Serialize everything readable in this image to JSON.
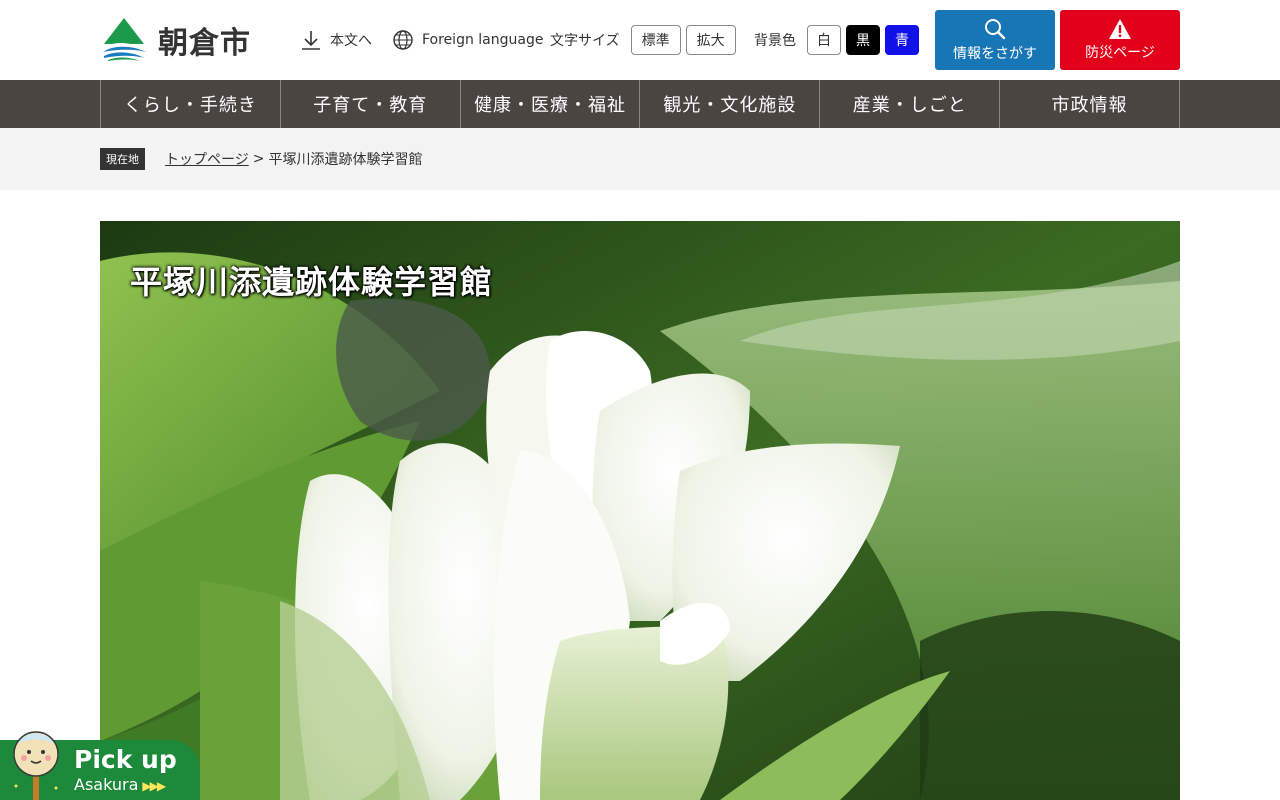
{
  "header": {
    "site_name": "朝倉市",
    "skip_link": "本文へ",
    "foreign_language": "Foreign language",
    "font_size": {
      "label": "文字サイズ",
      "options": [
        "標準",
        "拡大"
      ]
    },
    "bg_color": {
      "label": "背景色",
      "options": [
        "白",
        "黒",
        "青"
      ]
    },
    "search_button": "情報をさがす",
    "disaster_button": "防災ページ"
  },
  "nav": {
    "items": [
      "くらし・手続き",
      "子育て・教育",
      "健康・医療・福祉",
      "観光・文化施設",
      "産業・しごと",
      "市政情報"
    ]
  },
  "breadcrumb": {
    "tag": "現在地",
    "home": "トップページ",
    "separator": ">",
    "current": "平塚川添遺跡体験学習館"
  },
  "hero": {
    "title": "平塚川添遺跡体験学習館"
  },
  "pickup": {
    "title": "Pick up",
    "subtitle": "Asakura",
    "arrows": "▶▶▶"
  },
  "colors": {
    "nav_bg": "#4a4541",
    "search_btn": "#1676b6",
    "disaster_btn": "#e2001a",
    "pickup_bg": "#1c8a3a",
    "logo_green": "#1c9a4c",
    "logo_blue": "#1b7bc0"
  },
  "icons": {
    "skip": "download-arrow-icon",
    "language": "globe-icon",
    "search": "magnifier-icon",
    "disaster": "warning-triangle-icon"
  }
}
